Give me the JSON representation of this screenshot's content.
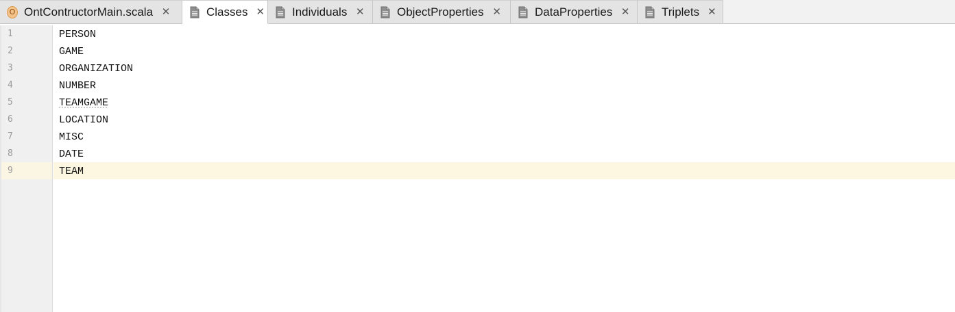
{
  "tabs": [
    {
      "label": "OntContructorMain.scala",
      "icon": "scala-object-icon",
      "active": false,
      "close": "✕"
    },
    {
      "label": "Classes",
      "icon": "text-file-icon",
      "active": true,
      "close": "✕"
    },
    {
      "label": "Individuals",
      "icon": "text-file-icon",
      "active": false,
      "close": "✕"
    },
    {
      "label": "ObjectProperties",
      "icon": "text-file-icon",
      "active": false,
      "close": "✕"
    },
    {
      "label": "DataProperties",
      "icon": "text-file-icon",
      "active": false,
      "close": "✕"
    },
    {
      "label": "Triplets",
      "icon": "text-file-icon",
      "active": false,
      "close": "✕"
    }
  ],
  "scala_badge_letter": "O",
  "editor": {
    "current_line": 9,
    "line_numbers": [
      "1",
      "2",
      "3",
      "4",
      "5",
      "6",
      "7",
      "8",
      "9"
    ],
    "lines": [
      "PERSON",
      "GAME",
      "ORGANIZATION",
      "NUMBER",
      "TEAMGAME",
      "LOCATION",
      "MISC",
      "DATE",
      "TEAM"
    ]
  },
  "colors": {
    "current_line_bg": "#fdf7e2",
    "gutter_bg": "#f0f0f0",
    "tab_bar_bg": "#f2f2f2",
    "active_tab_bg": "#ffffff"
  }
}
